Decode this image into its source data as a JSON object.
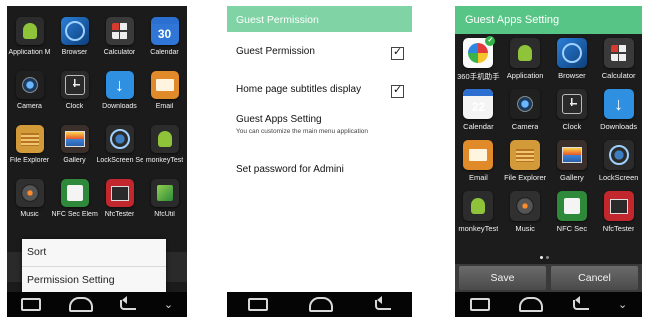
{
  "phone1": {
    "apps": [
      {
        "label": "Application M",
        "icon": "android-icon",
        "cls": "ic-android"
      },
      {
        "label": "Browser",
        "icon": "browser-icon",
        "cls": "ic-browser"
      },
      {
        "label": "Calculator",
        "icon": "calculator-icon",
        "cls": "ic-calc"
      },
      {
        "label": "Calendar",
        "icon": "calendar-icon",
        "cls": "ic-calendar blue",
        "glyph": "30"
      },
      {
        "label": "Camera",
        "icon": "camera-icon",
        "cls": "ic-camera"
      },
      {
        "label": "Clock",
        "icon": "clock-icon",
        "cls": "ic-clock"
      },
      {
        "label": "Downloads",
        "icon": "downloads-icon",
        "cls": "ic-downloads"
      },
      {
        "label": "Email",
        "icon": "email-icon",
        "cls": "ic-email"
      },
      {
        "label": "File Explorer",
        "icon": "file-explorer-icon",
        "cls": "ic-files"
      },
      {
        "label": "Gallery",
        "icon": "gallery-icon",
        "cls": "ic-gallery"
      },
      {
        "label": "LockScreen Se",
        "icon": "lockscreen-icon",
        "cls": "ic-lock"
      },
      {
        "label": "monkeyTest",
        "icon": "android-icon",
        "cls": "ic-android"
      },
      {
        "label": "Music",
        "icon": "music-icon",
        "cls": "ic-music"
      },
      {
        "label": "NFC Sec Elem",
        "icon": "nfc-icon",
        "cls": "ic-nfc"
      },
      {
        "label": "NfcTester",
        "icon": "nfc-tester-icon",
        "cls": "ic-nfctester"
      },
      {
        "label": "NfcUtil",
        "icon": "nfc-util-icon",
        "cls": "ic-nfcutil"
      }
    ],
    "menu": {
      "sort": "Sort",
      "permission_setting": "Permission Setting"
    }
  },
  "phone2": {
    "title": "Guest Permission",
    "rows": {
      "guest_permission": "Guest Permission",
      "subtitles": "Home page subtitles display",
      "guest_apps": "Guest Apps Setting",
      "guest_apps_sub": "You can customize the main menu application",
      "password": "Set password for Admini"
    },
    "checked": {
      "guest_permission": true,
      "subtitles": true
    }
  },
  "phone3": {
    "title": "Guest Apps Setting",
    "apps": [
      {
        "label": "360手机助手",
        "icon": "360-assistant-icon",
        "cls": "ic-360"
      },
      {
        "label": "Application",
        "icon": "android-icon",
        "cls": "ic-android"
      },
      {
        "label": "Browser",
        "icon": "browser-icon",
        "cls": "ic-browser"
      },
      {
        "label": "Calculator",
        "icon": "calculator-icon",
        "cls": "ic-calc"
      },
      {
        "label": "Calendar",
        "icon": "calendar-icon",
        "cls": "ic-calendar",
        "glyph": "22"
      },
      {
        "label": "Camera",
        "icon": "camera-icon",
        "cls": "ic-camera"
      },
      {
        "label": "Clock",
        "icon": "clock-icon",
        "cls": "ic-clock"
      },
      {
        "label": "Downloads",
        "icon": "downloads-icon",
        "cls": "ic-downloads"
      },
      {
        "label": "Email",
        "icon": "email-icon",
        "cls": "ic-email"
      },
      {
        "label": "File Explorer",
        "icon": "file-explorer-icon",
        "cls": "ic-files"
      },
      {
        "label": "Gallery",
        "icon": "gallery-icon",
        "cls": "ic-gallery"
      },
      {
        "label": "LockScreen",
        "icon": "lockscreen-icon",
        "cls": "ic-lock"
      },
      {
        "label": "monkeyTest",
        "icon": "android-icon",
        "cls": "ic-android"
      },
      {
        "label": "Music",
        "icon": "music-icon",
        "cls": "ic-music"
      },
      {
        "label": "NFC Sec",
        "icon": "nfc-icon",
        "cls": "ic-nfc"
      },
      {
        "label": "NfcTester",
        "icon": "nfc-tester-icon",
        "cls": "ic-nfctester"
      }
    ],
    "buttons": {
      "save": "Save",
      "cancel": "Cancel"
    }
  },
  "colors": {
    "guest_permission_header": "#7fd3a4",
    "guest_apps_header": "#56c585"
  }
}
